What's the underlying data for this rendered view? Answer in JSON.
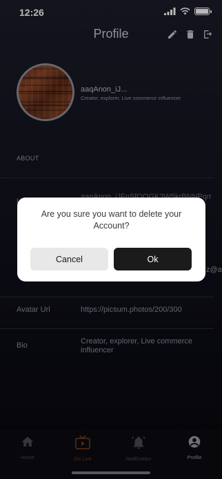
{
  "status_bar": {
    "time": "12:26"
  },
  "header": {
    "title": "Profile",
    "actions": [
      "edit-icon",
      "trash-icon",
      "logout-icon"
    ]
  },
  "profile": {
    "name": "aaqAnon_iJ...",
    "tagline": "Creator, explorer, Live commerce influencer"
  },
  "about": {
    "section_title": "ABOUT",
    "partial_label_u": "U",
    "partial_id_value": "aaqAnon_iJFnSfOOGK3W5krBNNPqmF",
    "partial_email_tail": "z@a",
    "avatar_url_label": "Avatar Url",
    "avatar_url_value": "https://picsum.photos/200/300",
    "bio_label": "Bio",
    "bio_value": "Creator, explorer, Live commerce influencer"
  },
  "dialog": {
    "message": "Are you sure you want to delete your Account?",
    "cancel_label": "Cancel",
    "ok_label": "Ok"
  },
  "tabbar": {
    "tabs": [
      {
        "label": "Home",
        "icon": "home-icon"
      },
      {
        "label": "Go Live",
        "icon": "tv-icon"
      },
      {
        "label": "Notification",
        "icon": "bell-icon"
      },
      {
        "label": "Profile",
        "icon": "account-icon"
      }
    ],
    "active": "Profile"
  },
  "colors": {
    "background": "#0b0b14",
    "go_live_accent": "#d4601c",
    "dialog_ok": "#1b1b1b",
    "dialog_cancel": "#e8e8e8"
  }
}
